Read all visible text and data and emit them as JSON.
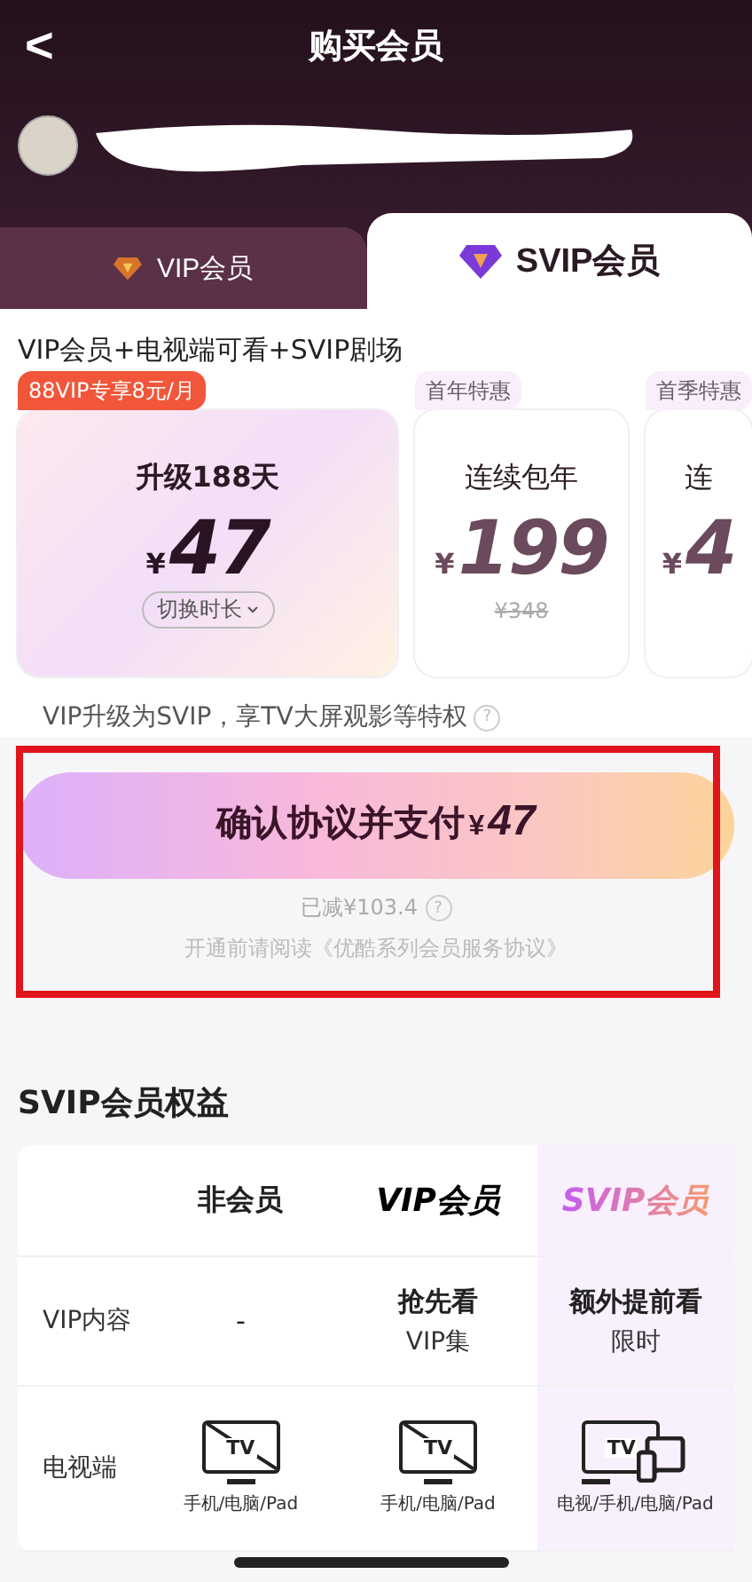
{
  "header": {
    "back": "<",
    "title": "购买会员"
  },
  "tabs": [
    {
      "label": "VIP会员",
      "selected": false
    },
    {
      "label": "SVIP会员",
      "selected": true
    }
  ],
  "subtitle": "VIP会员+电视端可看+SVIP剧场",
  "plans": [
    {
      "badge": "88VIP专享8元/月",
      "name": "升级188天",
      "currency": "¥",
      "price": "47",
      "switch": "切换时长",
      "selected": true
    },
    {
      "badge": "首年特惠",
      "name": "连续包年",
      "currency": "¥",
      "price": "199",
      "old_price": "¥348",
      "selected": false
    },
    {
      "badge": "首季特惠",
      "name": "连",
      "currency": "¥",
      "price": "4",
      "selected": false
    }
  ],
  "upgrade_note": "VIP升级为SVIP，享TV大屏观影等特权",
  "help": "?",
  "pay_button": {
    "label": "确认协议并支付",
    "currency": "¥",
    "price": "47"
  },
  "discount": "已减¥103.4",
  "agreement": "开通前请阅读《优酷系列会员服务协议》",
  "benefits": {
    "title": "SVIP会员权益",
    "columns": [
      {
        "label": "非会员",
        "kind": "plain"
      },
      {
        "label": "VIP会员",
        "kind": "bold"
      },
      {
        "label": "SVIP会员",
        "kind": "gradient"
      }
    ],
    "rows": [
      {
        "label": "VIP内容",
        "cells": [
          {
            "kind": "text",
            "main": "-"
          },
          {
            "kind": "text",
            "main": "抢先看",
            "sub": "VIP集"
          },
          {
            "kind": "text",
            "main": "额外提前看",
            "sub": "限时"
          }
        ]
      },
      {
        "label": "电视端",
        "cells": [
          {
            "kind": "no_tv",
            "icon_text": "TV",
            "sub": "手机/电脑/Pad"
          },
          {
            "kind": "no_tv",
            "icon_text": "TV",
            "sub": "手机/电脑/Pad"
          },
          {
            "kind": "tv",
            "icon_text": "TV",
            "sub": "电视/手机/电脑/Pad"
          }
        ]
      }
    ]
  }
}
